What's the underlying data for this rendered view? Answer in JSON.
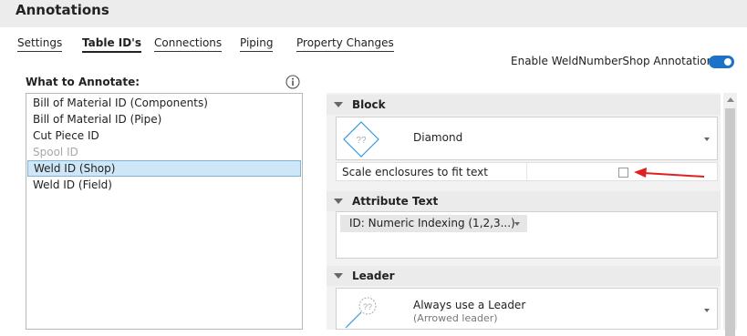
{
  "header": {
    "title": "Annotations"
  },
  "tabs": [
    {
      "label": "Settings"
    },
    {
      "label": "Table ID's",
      "active": true
    },
    {
      "label": "Connections"
    },
    {
      "label": "Piping"
    },
    {
      "label": "Property Changes"
    }
  ],
  "enable": {
    "label": "Enable WeldNumberShop Annotations:",
    "on": true
  },
  "annotate": {
    "label": "What to Annotate:",
    "info_icon": "info-icon",
    "items": [
      {
        "label": "Bill of Material ID (Components)"
      },
      {
        "label": "Bill of Material ID (Pipe)"
      },
      {
        "label": "Cut Piece ID"
      },
      {
        "label": "Spool ID",
        "disabled": true
      },
      {
        "label": "Weld ID (Shop)",
        "selected": true
      },
      {
        "label": "Weld ID (Field)"
      }
    ]
  },
  "block": {
    "header": "Block",
    "shape_label": "Diamond",
    "shape_icon_text": "??",
    "scale_label": "Scale enclosures to fit text",
    "scale_checked": false
  },
  "attribute": {
    "header": "Attribute Text",
    "combo_value": "ID: Numeric Indexing (1,2,3...)"
  },
  "leader": {
    "header": "Leader",
    "name": "Always use a Leader",
    "sub": "(Arrowed leader)",
    "icon_text": "??"
  },
  "colors": {
    "accent": "#1a73c8",
    "annotation_arrow": "#e02020",
    "selection": "#cfe6f7"
  }
}
